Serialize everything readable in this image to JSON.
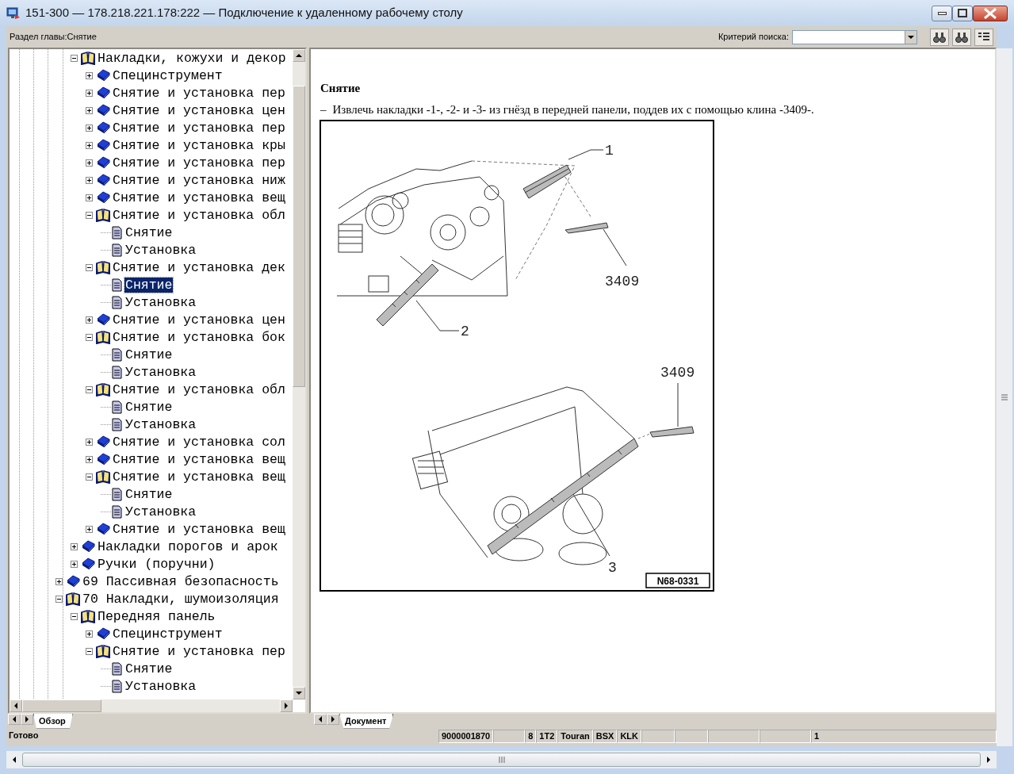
{
  "window": {
    "title": "151-300 — 178.218.221.178:222 — Подключение к удаленному рабочему столу"
  },
  "toolbar": {
    "section": "Раздел главы:Снятие",
    "search_label": "Критерий поиска:"
  },
  "tree": {
    "branch": [
      {
        "label": "Накладки, кожухи и декор",
        "kind": "book",
        "expanded": true,
        "selected": false,
        "children": [
          {
            "label": "Специнструмент",
            "kind": "book",
            "expanded": false,
            "selected": false
          },
          {
            "label": "Снятие и установка пер",
            "kind": "book",
            "expanded": false,
            "selected": false
          },
          {
            "label": "Снятие и установка цен",
            "kind": "book",
            "expanded": false,
            "selected": false
          },
          {
            "label": "Снятие и установка пер",
            "kind": "book",
            "expanded": false,
            "selected": false
          },
          {
            "label": "Снятие и установка кры",
            "kind": "book",
            "expanded": false,
            "selected": false
          },
          {
            "label": "Снятие и установка пер",
            "kind": "book",
            "expanded": false,
            "selected": false
          },
          {
            "label": "Снятие и установка ниж",
            "kind": "book",
            "expanded": false,
            "selected": false
          },
          {
            "label": "Снятие и установка вещ",
            "kind": "book",
            "expanded": false,
            "selected": false
          },
          {
            "label": "Снятие и установка обл",
            "kind": "book",
            "expanded": true,
            "selected": false,
            "children": [
              {
                "label": "Снятие",
                "kind": "page",
                "selected": false
              },
              {
                "label": "Установка",
                "kind": "page",
                "selected": false
              }
            ]
          },
          {
            "label": "Снятие и установка дек",
            "kind": "book",
            "expanded": true,
            "selected": false,
            "children": [
              {
                "label": "Снятие",
                "kind": "page",
                "selected": true
              },
              {
                "label": "Установка",
                "kind": "page",
                "selected": false
              }
            ]
          },
          {
            "label": "Снятие и установка цен",
            "kind": "book",
            "expanded": false,
            "selected": false
          },
          {
            "label": "Снятие и установка бок",
            "kind": "book",
            "expanded": true,
            "selected": false,
            "children": [
              {
                "label": "Снятие",
                "kind": "page",
                "selected": false
              },
              {
                "label": "Установка",
                "kind": "page",
                "selected": false
              }
            ]
          },
          {
            "label": "Снятие и установка обл",
            "kind": "book",
            "expanded": true,
            "selected": false,
            "children": [
              {
                "label": "Снятие",
                "kind": "page",
                "selected": false
              },
              {
                "label": "Установка",
                "kind": "page",
                "selected": false
              }
            ]
          },
          {
            "label": "Снятие и установка сол",
            "kind": "book",
            "expanded": false,
            "selected": false
          },
          {
            "label": "Снятие и установка вещ",
            "kind": "book",
            "expanded": false,
            "selected": false
          },
          {
            "label": "Снятие и установка вещ",
            "kind": "book",
            "expanded": true,
            "selected": false,
            "children": [
              {
                "label": "Снятие",
                "kind": "page",
                "selected": false
              },
              {
                "label": "Установка",
                "kind": "page",
                "selected": false
              }
            ]
          },
          {
            "label": "Снятие и установка вещ",
            "kind": "book",
            "expanded": false,
            "selected": false
          }
        ]
      },
      {
        "label": "Накладки порогов и арок",
        "kind": "book",
        "expanded": false,
        "selected": false
      },
      {
        "label": "Ручки (поручни)",
        "kind": "book",
        "expanded": false,
        "selected": false
      }
    ],
    "roots": [
      {
        "label": "69 Пассивная безопасность",
        "kind": "book",
        "expanded": false,
        "selected": false
      },
      {
        "label": "70 Накладки, шумоизоляция",
        "kind": "book",
        "expanded": true,
        "selected": false,
        "children": [
          {
            "label": "Передняя панель",
            "kind": "book",
            "expanded": true,
            "selected": false,
            "children": [
              {
                "label": "Специнструмент",
                "kind": "book",
                "expanded": false,
                "selected": false
              },
              {
                "label": "Снятие и установка пер",
                "kind": "book",
                "expanded": true,
                "selected": false,
                "children": [
                  {
                    "label": "Снятие",
                    "kind": "page",
                    "selected": false
                  },
                  {
                    "label": "Установка",
                    "kind": "page",
                    "selected": false
                  }
                ]
              }
            ]
          }
        ]
      }
    ]
  },
  "document": {
    "heading": "Снятие",
    "steps": [
      {
        "marker": "–",
        "text": "Извлечь накладки -1-, -2- и -3- из гнёзд в передней панели, поддев их с помощью клина -3409-."
      }
    ],
    "figure": {
      "callouts": [
        "1",
        "3409",
        "2",
        "3409",
        "3"
      ],
      "code": "N68-0331"
    }
  },
  "tabs": {
    "left": [
      {
        "label": "Обзор",
        "selected": true
      }
    ],
    "right": [
      {
        "label": "Документ",
        "selected": true
      }
    ]
  },
  "status_bar": {
    "text": "Готово",
    "fields": [
      {
        "kind": "text",
        "text": "9000001870"
      },
      {
        "kind": "blank"
      },
      {
        "kind": "text",
        "text": "8"
      },
      {
        "kind": "text",
        "text": "1T2"
      },
      {
        "kind": "text",
        "text": "Touran"
      },
      {
        "kind": "text",
        "text": "BSX"
      },
      {
        "kind": "text",
        "text": "KLK"
      },
      {
        "kind": "blank"
      },
      {
        "kind": "blank"
      },
      {
        "kind": "blank"
      },
      {
        "kind": "blank"
      },
      {
        "kind": "text",
        "text": "1"
      }
    ]
  }
}
